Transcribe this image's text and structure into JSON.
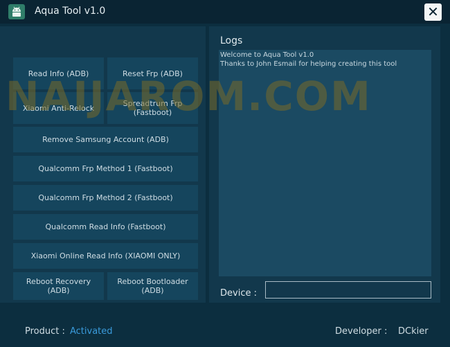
{
  "window": {
    "title": "Aqua Tool v1.0",
    "close_label": "✕",
    "app_icon": "android-icon"
  },
  "buttons": {
    "read_info_adb": "Read Info (ADB)",
    "reset_frp_adb": "Reset Frp (ADB)",
    "xiaomi_anti_relock": "Xiaomi Anti-Relock",
    "spreadtrum_frp": "Spreadtrum Frp\n(Fastboot)",
    "remove_samsung": "Remove Samsung Account (ADB)",
    "qualcomm_frp_1": "Qualcomm Frp Method 1 (Fastboot)",
    "qualcomm_frp_2": "Qualcomm Frp Method 2 (Fastboot)",
    "qualcomm_read_info": "Qualcomm Read Info (Fastboot)",
    "xiaomi_online_read": "Xiaomi Online Read Info (XIAOMI ONLY)",
    "reboot_recovery": "Reboot Recovery\n(ADB)",
    "reboot_bootloader": "Reboot Bootloader\n(ADB)"
  },
  "logs": {
    "title": "Logs",
    "lines": [
      "Welcome to Aqua Tool v1.0",
      "Thanks to John Esmail for helping creating this tool"
    ]
  },
  "device": {
    "label": "Device :",
    "value": ""
  },
  "watermark": "NAIJAROM.COM",
  "footer": {
    "product_label": "Product :",
    "product_status": "Activated",
    "developer_label": "Developer :",
    "developer_name": "DCkier"
  },
  "colors": {
    "background": "#0c2e3f",
    "panel": "#12384c",
    "button": "#15455d",
    "activated": "#3a9bdc"
  }
}
